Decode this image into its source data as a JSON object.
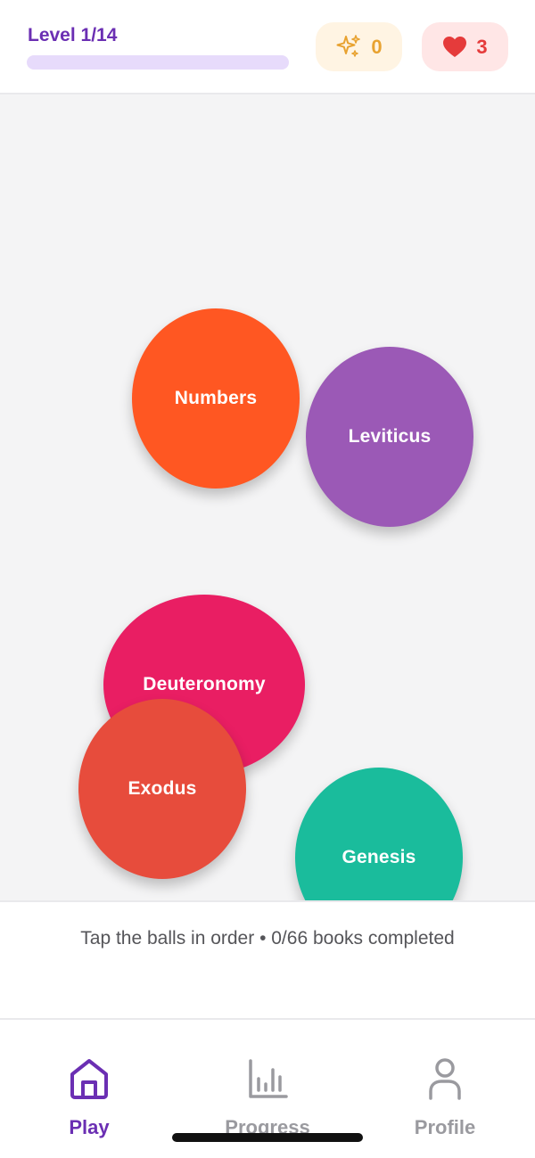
{
  "header": {
    "level_label": "Level 1/14",
    "level_progress": 0,
    "stars_count": "0",
    "lives_count": "3",
    "icons": {
      "stars": "sparkles-icon",
      "lives": "heart-icon"
    }
  },
  "game": {
    "balls": [
      {
        "label": "Numbers",
        "color": "#ff5722"
      },
      {
        "label": "Leviticus",
        "color": "#9b59b6"
      },
      {
        "label": "Deuteronomy",
        "color": "#e91e63"
      },
      {
        "label": "Exodus",
        "color": "#e74c3c"
      },
      {
        "label": "Genesis",
        "color": "#1abc9c"
      }
    ]
  },
  "instruction": {
    "text": "Tap the balls in order • 0/66 books completed"
  },
  "nav": {
    "items": [
      {
        "label": "Play",
        "icon": "home-icon",
        "active": true
      },
      {
        "label": "Progress",
        "icon": "bar-chart-icon",
        "active": false
      },
      {
        "label": "Profile",
        "icon": "user-icon",
        "active": false
      }
    ]
  },
  "colors": {
    "accent": "#6b2fb3",
    "stars": "#e8a230",
    "lives": "#e53b3b",
    "inactive": "#9a9a9f"
  }
}
